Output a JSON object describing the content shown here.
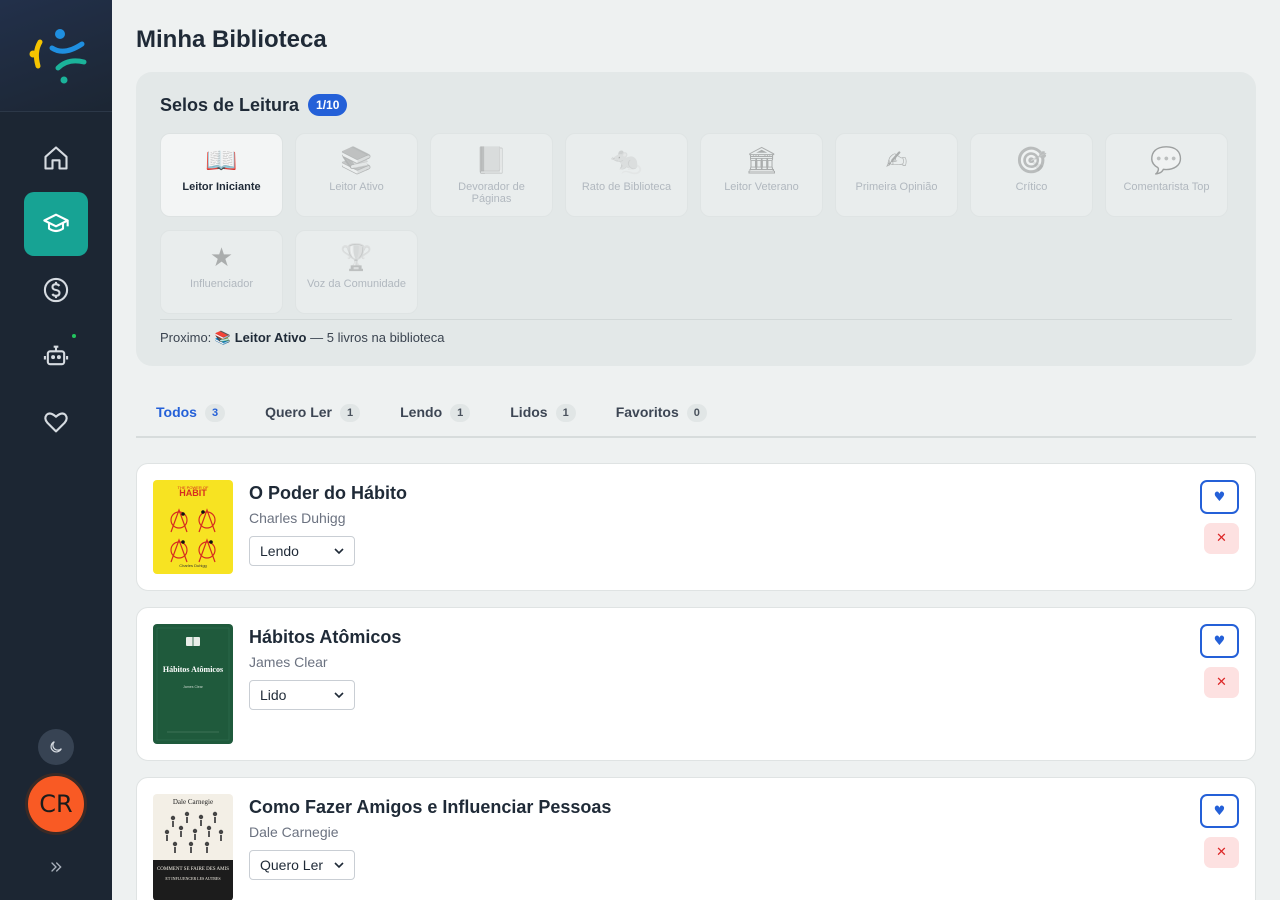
{
  "app": {
    "page_title": "Minha Biblioteca",
    "user_initials": "CR"
  },
  "sidebar": {
    "items": [
      {
        "name": "home",
        "icon": "home-icon",
        "active": false
      },
      {
        "name": "learning",
        "icon": "graduation-cap-icon",
        "active": true
      },
      {
        "name": "finance",
        "icon": "dollar-circle-icon",
        "active": false
      },
      {
        "name": "assistant",
        "icon": "robot-icon",
        "active": false
      },
      {
        "name": "favorites",
        "icon": "heart-icon",
        "active": false
      }
    ]
  },
  "badges": {
    "title": "Selos de Leitura",
    "count": "1/10",
    "items": [
      {
        "label": "Leitor Iniciante",
        "icon": "📖",
        "unlocked": true
      },
      {
        "label": "Leitor Ativo",
        "icon": "📚",
        "unlocked": false
      },
      {
        "label": "Devorador de Páginas",
        "icon": "📗",
        "unlocked": false
      },
      {
        "label": "Rato de Biblioteca",
        "icon": "🐀",
        "unlocked": false
      },
      {
        "label": "Leitor Veterano",
        "icon": "🏛",
        "unlocked": false
      },
      {
        "label": "Primeira Opinião",
        "icon": "✍",
        "unlocked": false
      },
      {
        "label": "Crítico",
        "icon": "🎯",
        "unlocked": false
      },
      {
        "label": "Comentarista Top",
        "icon": "💬",
        "unlocked": false
      },
      {
        "label": "Influenciador",
        "icon": "★",
        "unlocked": false
      },
      {
        "label": "Voz da Comunidade",
        "icon": "🏆",
        "unlocked": false
      }
    ],
    "next_prefix": "Proximo:",
    "next_icon": "📚",
    "next_badge": "Leitor Ativo",
    "next_suffix": "— 5 livros na biblioteca"
  },
  "tabs": [
    {
      "label": "Todos",
      "count": "3",
      "active": true
    },
    {
      "label": "Quero Ler",
      "count": "1",
      "active": false
    },
    {
      "label": "Lendo",
      "count": "1",
      "active": false
    },
    {
      "label": "Lidos",
      "count": "1",
      "active": false
    },
    {
      "label": "Favoritos",
      "count": "0",
      "active": false
    }
  ],
  "books": [
    {
      "title": "O Poder do Hábito",
      "author": "Charles Duhigg",
      "status": "Lendo",
      "cover_top_text": "THE POWER OF",
      "cover_title": "HABIT",
      "cover_author": "Charles Duhigg",
      "cover_color": "#f7e322"
    },
    {
      "title": "Hábitos Atômicos",
      "author": "James Clear",
      "status": "Lido",
      "cover_title": "Hábitos Atômicos",
      "cover_author": "James Clear",
      "cover_color": "#1f5a3c"
    },
    {
      "title": "Como Fazer Amigos e Influenciar Pessoas",
      "author": "Dale Carnegie",
      "status": "Quero Ler",
      "cover_author": "Dale Carnegie",
      "cover_title": "COMMENT SE FAIRE DES AMIS",
      "cover_subtitle": "ET INFLUENCER LES AUTRES",
      "cover_color": "#f3efe6"
    }
  ],
  "colors": {
    "accent": "#2460d8",
    "sidebar_active": "#17a394",
    "sidebar_bg": "#1c2633",
    "avatar": "#f95a24",
    "danger_bg": "#fde1e1"
  }
}
